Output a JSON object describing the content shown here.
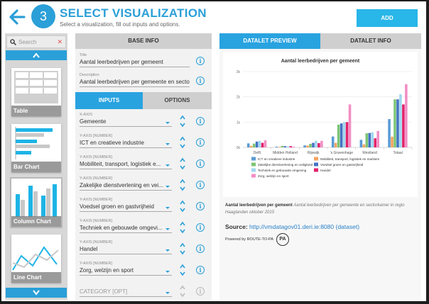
{
  "header": {
    "step": "3",
    "title": "SELECT VISUALIZATION",
    "subtitle": "Select a visualization, fill out inputs and options.",
    "add_label": "ADD"
  },
  "sidebar": {
    "search_placeholder": "Search",
    "items": [
      {
        "label": "Table",
        "icon": "table-icon"
      },
      {
        "label": "Bar Chart",
        "icon": "bar-chart-icon"
      },
      {
        "label": "Column Chart",
        "icon": "column-chart-icon"
      },
      {
        "label": "Line Chart",
        "icon": "line-chart-icon"
      }
    ],
    "selected": "Column Chart"
  },
  "base_info": {
    "heading": "BASE INFO",
    "title_caption": "Title",
    "title_value": "Aantal leerbedrijven per gemeent",
    "description_caption": "Description",
    "description_value": "Aantal leerbedrijven per gemeente en sector"
  },
  "tabs": {
    "inputs": "INPUTS",
    "options": "OPTIONS"
  },
  "inputs": [
    {
      "caption": "X-AXIS",
      "value": "Gemeente"
    },
    {
      "caption": "Y-AXIS [NUMBER]",
      "value": "ICT en creatieve industrie"
    },
    {
      "caption": "Y-AXIS [NUMBER]",
      "value": "Mobiliteit, transport, logistiek e..."
    },
    {
      "caption": "Y-AXIS [NUMBER]",
      "value": "Zakelijke dienstverlening en vei..."
    },
    {
      "caption": "Y-AXIS [NUMBER]",
      "value": "Voedsel groen en gastvrijheid"
    },
    {
      "caption": "Y-AXIS [NUMBER]",
      "value": "Techniek en gebouwde omgevi..."
    },
    {
      "caption": "Y-AXIS [NUMBER]",
      "value": "Handel"
    },
    {
      "caption": "Y-AXIS [NUMBER]",
      "value": "Zorg, welzijn en sport"
    },
    {
      "caption": "",
      "value": "CATEGORY [OPT]"
    }
  ],
  "preview": {
    "tab_preview": "DATALET PREVIEW",
    "tab_info": "DATALET INFO",
    "desc_bold": "Aantal leerbedrijven per gemeent",
    "desc_italic": "Aantal leerbedrijven per gemeente en sectorkamer in regio Haaglanden oktober 2015",
    "source_label": "Source:",
    "source_url": "http://vmdatagov01.deri.ie:8080",
    "source_link": "(dataset)",
    "powered": "Powered by ROUTE-TO-PA",
    "pa_logo": "PA"
  },
  "chart_data": {
    "type": "bar",
    "title": "Aantal leerbedrijven per gemeent",
    "categories": [
      "Delft",
      "Midden Holland",
      "Rijswijk",
      "'s Gravenhage",
      "Westland",
      "Totaal"
    ],
    "ylim": [
      0,
      3000
    ],
    "yticks": [
      "0k",
      "1k",
      "2k",
      "3k"
    ],
    "legend_position": "bottom",
    "series": [
      {
        "name": "ICT en creatieve industrie",
        "color": "#5b9bd5",
        "values": [
          160,
          30,
          80,
          430,
          300,
          1120
        ]
      },
      {
        "name": "Mobiliteit, transport, logistiek en maritiem",
        "color": "#f4a460",
        "values": [
          60,
          20,
          70,
          180,
          120,
          420
        ]
      },
      {
        "name": "Zakelijke dienstverlening en veiligheid",
        "color": "#7cc576",
        "values": [
          150,
          60,
          140,
          900,
          560,
          1900
        ]
      },
      {
        "name": "Voedsel groen en gastvrijheid",
        "color": "#4472c4",
        "values": [
          230,
          50,
          180,
          950,
          570,
          1900
        ]
      },
      {
        "name": "Techniek en gebouwde omgeving",
        "color": "#a0d8ef",
        "values": [
          260,
          40,
          260,
          1000,
          600,
          2100
        ]
      },
      {
        "name": "Handel",
        "color": "#e2226a",
        "values": [
          180,
          50,
          170,
          1000,
          360,
          1700
        ]
      },
      {
        "name": "Zorg, welzijn en sport",
        "color": "#f28ec5",
        "values": [
          280,
          30,
          260,
          1700,
          650,
          2500
        ]
      }
    ]
  }
}
